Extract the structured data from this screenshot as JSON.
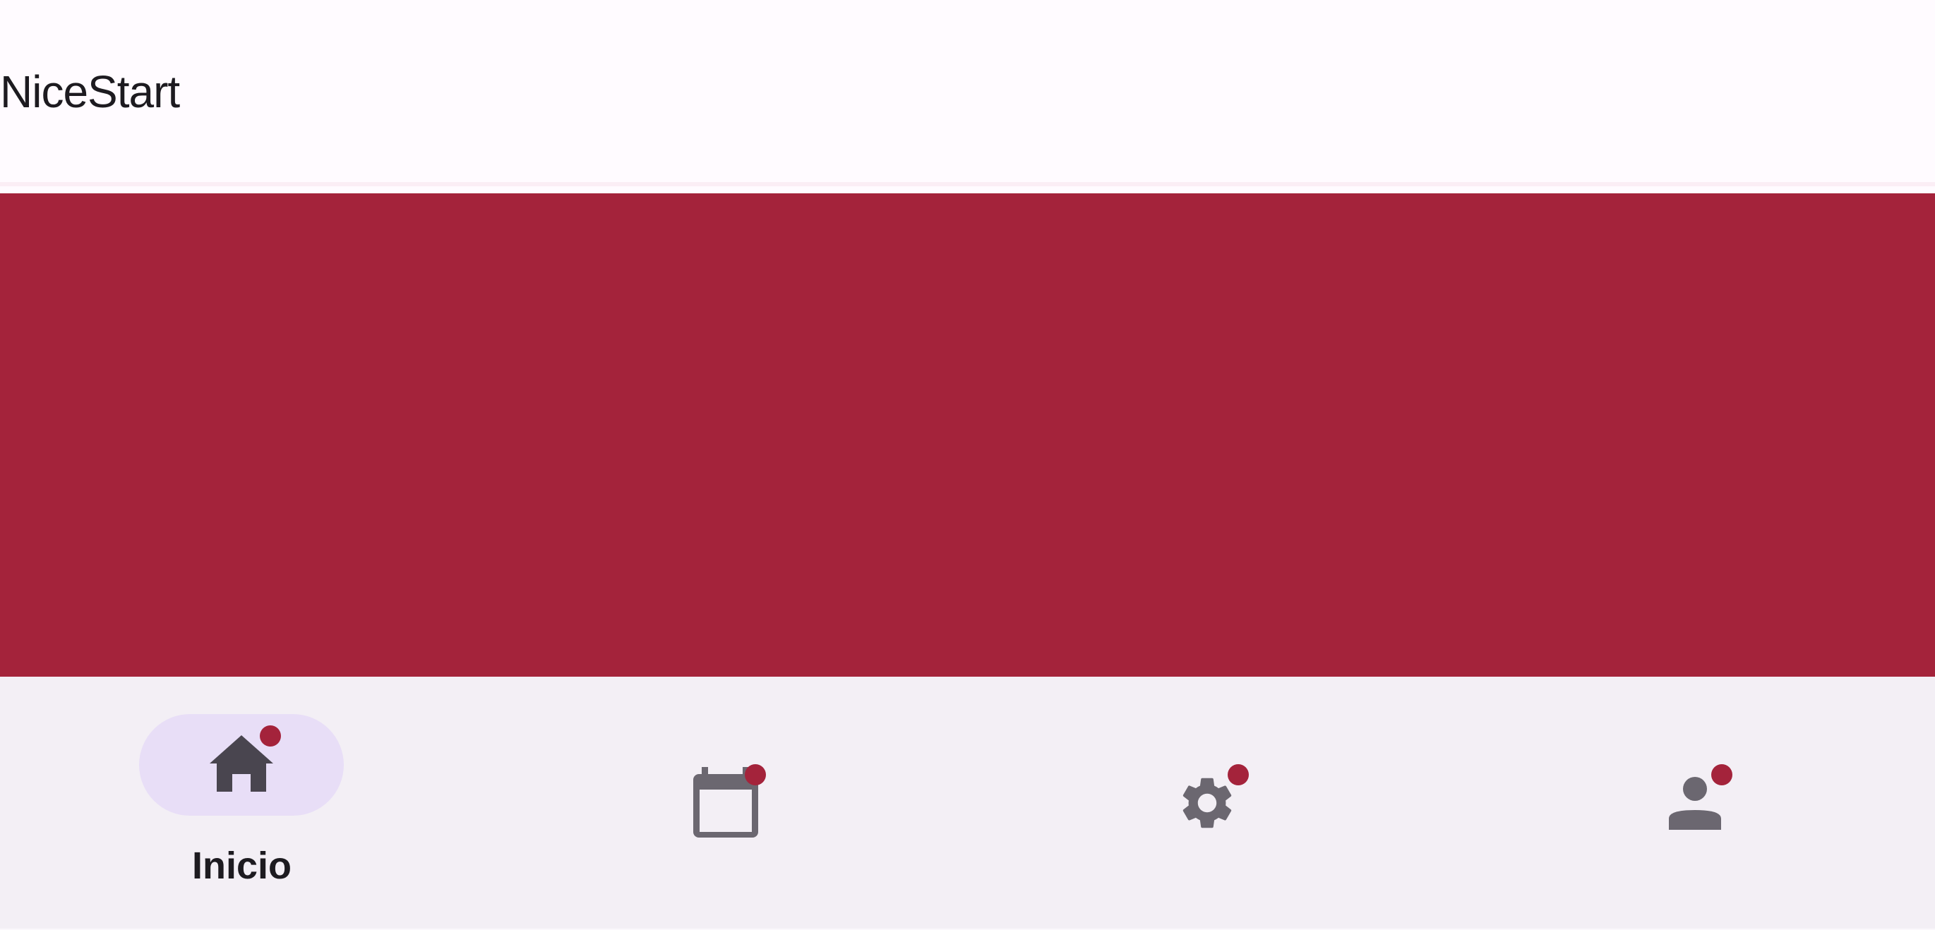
{
  "app": {
    "title": "NiceStart"
  },
  "colors": {
    "primary": "#a4233b",
    "surface": "#fffbff",
    "nav_background": "#f3eff5",
    "active_indicator": "#e8def7",
    "active_icon": "#49454f",
    "inactive_icon": "#6b6770",
    "text": "#1d1b20"
  },
  "bottom_nav": {
    "selected": "home",
    "items": [
      {
        "id": "home",
        "icon": "home-icon",
        "label": "Inicio",
        "badge": true
      },
      {
        "id": "calendar",
        "icon": "calendar-icon",
        "label": "",
        "badge": true
      },
      {
        "id": "settings",
        "icon": "gear-icon",
        "label": "",
        "badge": true
      },
      {
        "id": "profile",
        "icon": "person-icon",
        "label": "",
        "badge": true
      }
    ]
  }
}
